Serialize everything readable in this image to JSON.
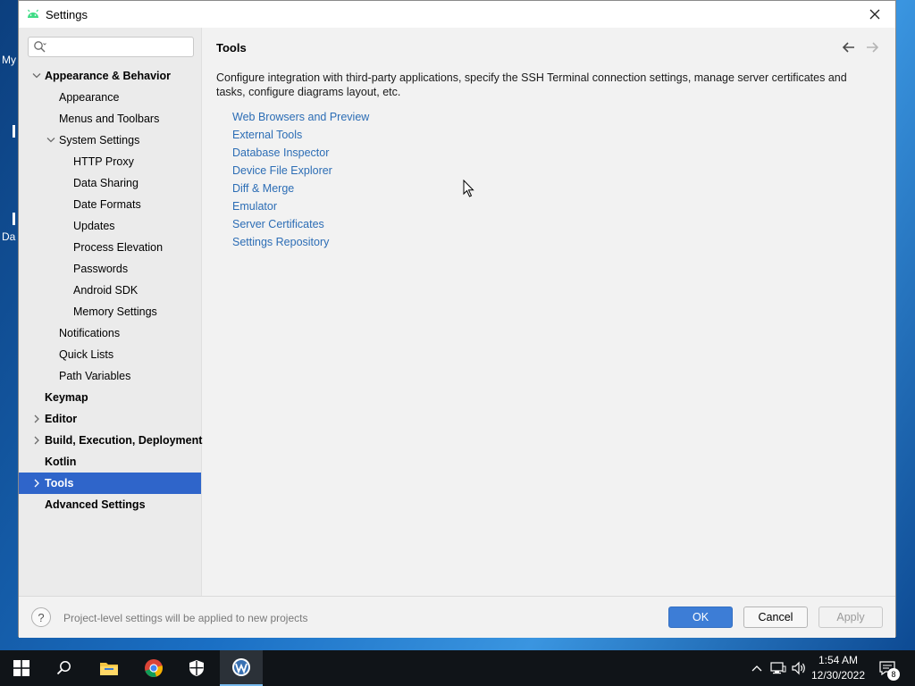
{
  "desktop": {
    "labels": [
      "My",
      "Da"
    ]
  },
  "window": {
    "title": "Settings",
    "close_label": "✕"
  },
  "search": {
    "placeholder": ""
  },
  "sidebar": {
    "items": [
      {
        "label": "Appearance & Behavior",
        "level": 0,
        "bold": true,
        "expanded": true
      },
      {
        "label": "Appearance",
        "level": 1
      },
      {
        "label": "Menus and Toolbars",
        "level": 1
      },
      {
        "label": "System Settings",
        "level": 1,
        "expanded": true
      },
      {
        "label": "HTTP Proxy",
        "level": 2
      },
      {
        "label": "Data Sharing",
        "level": 2
      },
      {
        "label": "Date Formats",
        "level": 2
      },
      {
        "label": "Updates",
        "level": 2
      },
      {
        "label": "Process Elevation",
        "level": 2
      },
      {
        "label": "Passwords",
        "level": 2
      },
      {
        "label": "Android SDK",
        "level": 2
      },
      {
        "label": "Memory Settings",
        "level": 2
      },
      {
        "label": "Notifications",
        "level": 1
      },
      {
        "label": "Quick Lists",
        "level": 1
      },
      {
        "label": "Path Variables",
        "level": 1
      },
      {
        "label": "Keymap",
        "level": 0,
        "bold": true
      },
      {
        "label": "Editor",
        "level": 0,
        "bold": true,
        "collapsed": true
      },
      {
        "label": "Build, Execution, Deployment",
        "level": 0,
        "bold": true,
        "collapsed": true
      },
      {
        "label": "Kotlin",
        "level": 0,
        "bold": true
      },
      {
        "label": "Tools",
        "level": 0,
        "bold": true,
        "collapsed": true,
        "selected": true
      },
      {
        "label": "Advanced Settings",
        "level": 0,
        "bold": true
      }
    ]
  },
  "content": {
    "title": "Tools",
    "description": "Configure integration with third-party applications, specify the SSH Terminal connection settings, manage server certificates and tasks, configure diagrams layout, etc.",
    "links": [
      "Web Browsers and Preview",
      "External Tools",
      "Database Inspector",
      "Device File Explorer",
      "Diff & Merge",
      "Emulator",
      "Server Certificates",
      "Settings Repository"
    ]
  },
  "footer": {
    "help_label": "?",
    "note": "Project-level settings will be applied to new projects",
    "ok_label": "OK",
    "cancel_label": "Cancel",
    "apply_label": "Apply"
  },
  "taskbar": {
    "time": "1:54 AM",
    "date": "12/30/2022",
    "notification_count": "8",
    "apps": [
      "windows-start-icon",
      "search-icon",
      "file-explorer-icon",
      "chrome-icon",
      "windows-security-icon",
      "android-studio-icon"
    ]
  },
  "colors": {
    "selection": "#2f65ca",
    "link": "#2c6db5",
    "ok_button": "#3d7dd6"
  }
}
